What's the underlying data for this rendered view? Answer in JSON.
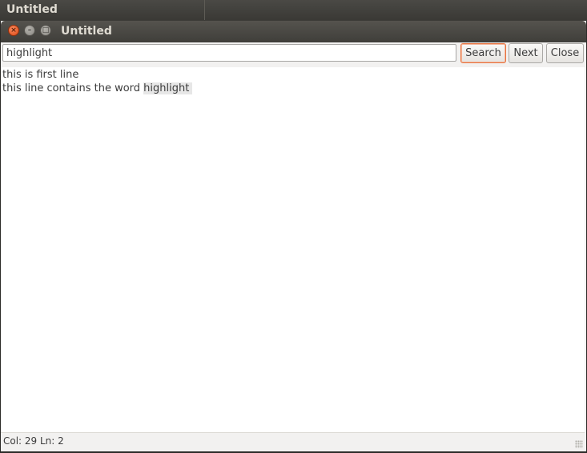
{
  "desktop": {
    "title": "Untitled"
  },
  "window": {
    "title": "Untitled",
    "controls": {
      "close_icon": "close-icon",
      "minimize_icon": "minimize-icon",
      "maximize_icon": "maximize-icon"
    }
  },
  "search": {
    "value": "highlight",
    "search_label": "Search",
    "next_label": "Next",
    "close_label": "Close"
  },
  "editor": {
    "line1": "this is first line",
    "line2_prefix": "this line contains the word ",
    "line2_highlight": "highlight"
  },
  "status": {
    "text": "Col: 29 Ln: 2"
  },
  "colors": {
    "accent": "#e6733f",
    "titlebar": "#3f3e3a",
    "highlight": "#e7e7e7"
  }
}
